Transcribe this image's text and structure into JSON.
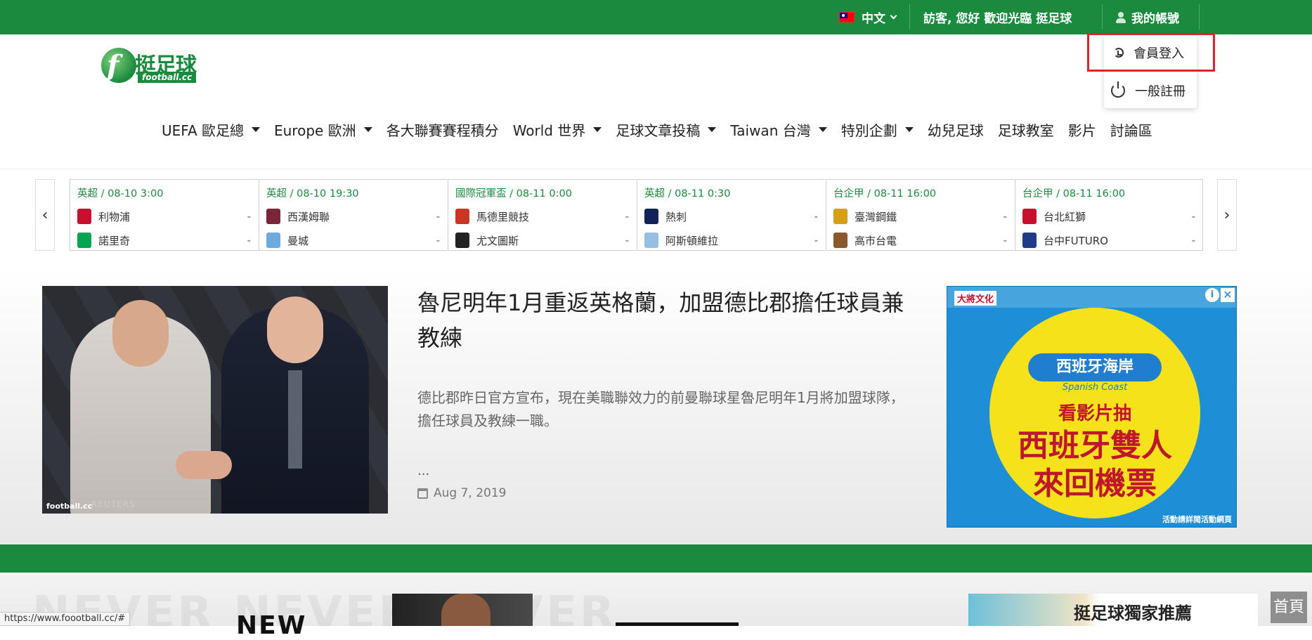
{
  "topbar": {
    "lang_label": "中文",
    "welcome": "訪客, 您好 歡迎光臨 挺足球",
    "account_label": "我的帳號"
  },
  "account_menu": {
    "login": "會員登入",
    "register": "一般註冊"
  },
  "logo": {
    "brand_cn": "挺足球",
    "brand_domain": "football.cc"
  },
  "nav": [
    {
      "label": "UEFA 歐足總",
      "dropdown": true
    },
    {
      "label": "Europe 歐洲",
      "dropdown": true
    },
    {
      "label": "各大聯賽賽程積分",
      "dropdown": false
    },
    {
      "label": "World 世界",
      "dropdown": true
    },
    {
      "label": "足球文章投稿",
      "dropdown": true
    },
    {
      "label": "Taiwan 台灣",
      "dropdown": true
    },
    {
      "label": "特別企劃",
      "dropdown": true
    },
    {
      "label": "幼兒足球",
      "dropdown": false
    },
    {
      "label": "足球教室",
      "dropdown": false
    },
    {
      "label": "影片",
      "dropdown": false
    },
    {
      "label": "討論區",
      "dropdown": false
    }
  ],
  "scores": {
    "prev_label": "‹",
    "next_label": "›",
    "matches": [
      {
        "league": "英超",
        "time": "08-10 3:00",
        "home": "利物浦",
        "away": "諾里奇",
        "home_score": "-",
        "away_score": "-",
        "home_color": "#c8102e",
        "away_color": "#00a650"
      },
      {
        "league": "英超",
        "time": "08-10 19:30",
        "home": "西漢姆聯",
        "away": "曼城",
        "home_score": "-",
        "away_score": "-",
        "home_color": "#7a263a",
        "away_color": "#6cabdd"
      },
      {
        "league": "國際冠軍盃",
        "time": "08-11 0:00",
        "home": "馬德里競技",
        "away": "尤文圖斯",
        "home_score": "-",
        "away_score": "-",
        "home_color": "#cb3524",
        "away_color": "#222222"
      },
      {
        "league": "英超",
        "time": "08-11 0:30",
        "home": "熱刺",
        "away": "阿斯頓維拉",
        "home_score": "-",
        "away_score": "-",
        "home_color": "#132257",
        "away_color": "#95bfe5"
      },
      {
        "league": "台企甲",
        "time": "08-11 16:00",
        "home": "臺灣鋼鐵",
        "away": "高市台電",
        "home_score": "-",
        "away_score": "-",
        "home_color": "#d4a017",
        "away_color": "#8b5a2b"
      },
      {
        "league": "台企甲",
        "time": "08-11 16:00",
        "home": "台北紅獅",
        "away": "台中FUTURO",
        "home_score": "-",
        "away_score": "-",
        "home_color": "#c8102e",
        "away_color": "#1f3c88"
      }
    ]
  },
  "article": {
    "headline": "魯尼明年1月重返英格蘭，加盟德比郡擔任球員兼教練",
    "summary": "德比郡昨日官方宣布，現在美職聯效力的前曼聯球星魯尼明年1月將加盟球隊，擔任球員及教練一職。",
    "ellipsis": "...",
    "date": "Aug 7, 2019",
    "photo_watermark": "football.cc",
    "photo_credit": "REUTERS"
  },
  "ad": {
    "brand": "大將文化",
    "info_label": "i",
    "close_label": "✕",
    "title": "西班牙海岸",
    "title_en": "Spanish Coast",
    "line1": "看影片抽",
    "line2": "西班牙雙人來回機票",
    "footer": "活動請詳閱活動網頁"
  },
  "bottom": {
    "banner_text": "NEVER NEVER NEVER",
    "promo_new": "NEW",
    "promo_right": "挺足球獨家推薦",
    "home_button": "首頁"
  },
  "status_url": "https://www.foootball.cc/#",
  "colors": {
    "brand_green": "#1a8a3e",
    "highlight_red": "#e0222a"
  }
}
